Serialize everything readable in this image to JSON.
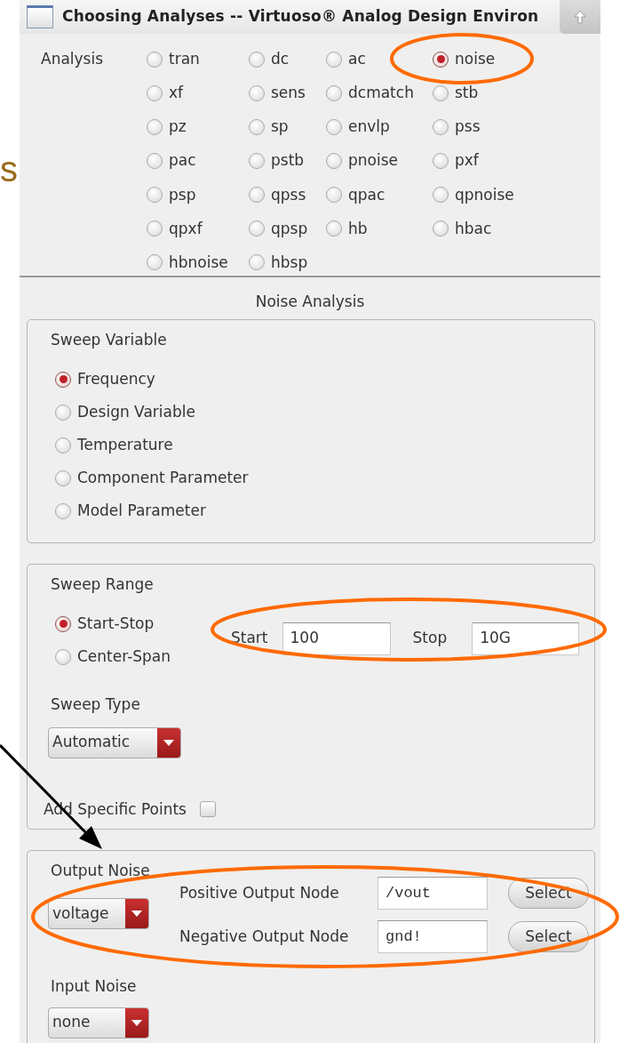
{
  "slide_fragment": "s",
  "window": {
    "title": "Choosing Analyses -- Virtuoso® Analog Design Environ"
  },
  "analysis": {
    "label": "Analysis",
    "options": [
      {
        "label": "tran",
        "selected": false
      },
      {
        "label": "dc",
        "selected": false
      },
      {
        "label": "ac",
        "selected": false
      },
      {
        "label": "noise",
        "selected": true
      },
      {
        "label": "xf",
        "selected": false
      },
      {
        "label": "sens",
        "selected": false
      },
      {
        "label": "dcmatch",
        "selected": false
      },
      {
        "label": "stb",
        "selected": false
      },
      {
        "label": "pz",
        "selected": false
      },
      {
        "label": "sp",
        "selected": false
      },
      {
        "label": "envlp",
        "selected": false
      },
      {
        "label": "pss",
        "selected": false
      },
      {
        "label": "pac",
        "selected": false
      },
      {
        "label": "pstb",
        "selected": false
      },
      {
        "label": "pnoise",
        "selected": false
      },
      {
        "label": "pxf",
        "selected": false
      },
      {
        "label": "psp",
        "selected": false
      },
      {
        "label": "qpss",
        "selected": false
      },
      {
        "label": "qpac",
        "selected": false
      },
      {
        "label": "qpnoise",
        "selected": false
      },
      {
        "label": "qpxf",
        "selected": false
      },
      {
        "label": "qpsp",
        "selected": false
      },
      {
        "label": "hb",
        "selected": false
      },
      {
        "label": "hbac",
        "selected": false
      },
      {
        "label": "hbnoise",
        "selected": false
      },
      {
        "label": "hbsp",
        "selected": false
      }
    ]
  },
  "section_title": "Noise Analysis",
  "sweep_variable": {
    "label": "Sweep Variable",
    "options": [
      {
        "label": "Frequency",
        "selected": true
      },
      {
        "label": "Design Variable",
        "selected": false
      },
      {
        "label": "Temperature",
        "selected": false
      },
      {
        "label": "Component Parameter",
        "selected": false
      },
      {
        "label": "Model Parameter",
        "selected": false
      }
    ]
  },
  "sweep_range": {
    "label": "Sweep Range",
    "options": [
      {
        "label": "Start-Stop",
        "selected": true
      },
      {
        "label": "Center-Span",
        "selected": false
      }
    ],
    "start": {
      "label": "Start",
      "value": "100"
    },
    "stop": {
      "label": "Stop",
      "value": "10G"
    }
  },
  "sweep_type": {
    "label": "Sweep Type",
    "value": "Automatic"
  },
  "add_specific_points": {
    "label": "Add Specific Points",
    "checked": false
  },
  "output_noise": {
    "label": "Output Noise",
    "value": "voltage",
    "nodes": [
      {
        "label": "Positive Output Node",
        "value": "/vout",
        "button": "Select"
      },
      {
        "label": "Negative Output Node",
        "value": "gnd!",
        "button": "Select"
      }
    ]
  },
  "input_noise": {
    "label": "Input Noise",
    "value": "none"
  }
}
